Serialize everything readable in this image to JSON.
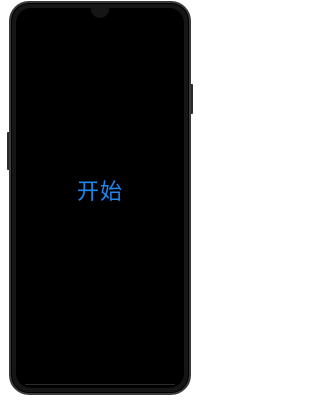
{
  "screen": {
    "start_label": "开始"
  },
  "colors": {
    "screen_background": "#000000",
    "phone_frame": "#151515",
    "accent_text": "#1e88f0"
  }
}
